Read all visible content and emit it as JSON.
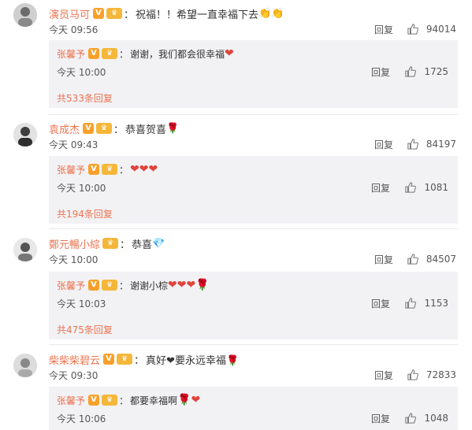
{
  "comments": [
    {
      "user": "演员马可",
      "text": "祝福！！希望一直幸福下去",
      "suffix": "👏👏",
      "time": "今天 09:56",
      "reply_label": "回复",
      "likes": "94014",
      "reply": {
        "user": "张馨予",
        "text": "谢谢，我们都会很幸福",
        "suffix": "❤",
        "time": "今天 10:00",
        "reply_label": "回复",
        "likes": "1725"
      },
      "more": "共533条回复"
    },
    {
      "user": "袁成杰",
      "text": "恭喜贺喜",
      "suffix": "🌹",
      "time": "今天 09:43",
      "reply_label": "回复",
      "likes": "84197",
      "reply": {
        "user": "张馨予",
        "text": "",
        "suffix": "❤❤❤",
        "time": "今天 10:00",
        "reply_label": "回复",
        "likes": "1081"
      },
      "more": "共194条回复"
    },
    {
      "user": "鄭元暢小綜",
      "text": "恭喜",
      "suffix": "💎",
      "time": "今天 10:00",
      "reply_label": "回复",
      "likes": "84507",
      "reply": {
        "user": "张馨予",
        "text": "谢谢小棕",
        "suffix": "❤❤❤🌹",
        "time": "今天 10:03",
        "reply_label": "回复",
        "likes": "1153"
      },
      "more": "共475条回复"
    },
    {
      "user": "柴柴柴碧云",
      "text": "真好",
      "suffix": "❤要永远幸福🌹",
      "time": "今天 09:30",
      "reply_label": "回复",
      "likes": "72833",
      "reply": {
        "user": "张馨予",
        "text": "都要幸福啊",
        "suffix": "🌹❤",
        "time": "今天 10:06",
        "reply_label": "回复",
        "likes": "1048"
      },
      "more": ""
    }
  ],
  "badge_vip": "V",
  "badge_fan": "♛",
  "colors": {
    "username": "#eb7350",
    "heart": "#e0443a",
    "reply_bg": "#f2f2f5"
  }
}
